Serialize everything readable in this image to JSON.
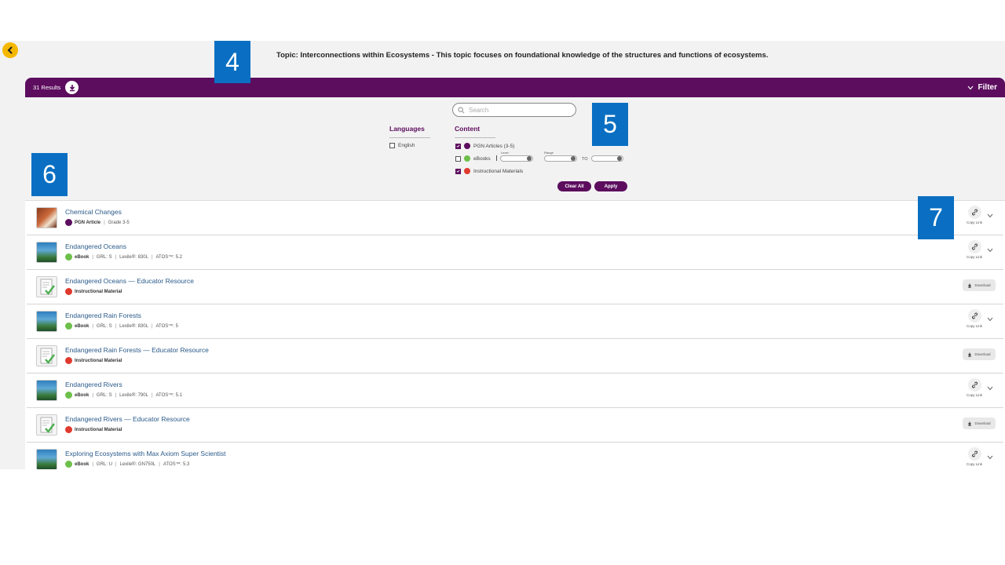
{
  "topic_text": "Topic: Interconnections within Ecosystems - This topic focuses on foundational knowledge of the structures and functions of ecosystems.",
  "results_bar": {
    "count": "31 Results",
    "filter_label": "Filter"
  },
  "search": {
    "placeholder": "Search"
  },
  "filters": {
    "languages": {
      "heading": "Languages",
      "options": [
        {
          "label": "English",
          "checked": false
        }
      ]
    },
    "content": {
      "heading": "Content",
      "options": [
        {
          "label": "PGN Articles (3-5)",
          "checked": true
        },
        {
          "label": "eBooks",
          "checked": false
        },
        {
          "label": "Instructional Materials",
          "checked": true
        }
      ],
      "level_label": "Level",
      "range_label": "Range",
      "to_label": "TO"
    },
    "clear_label": "Clear All",
    "apply_label": "Apply"
  },
  "items": [
    {
      "title": "Chemical Changes",
      "type": "PGN Article",
      "details": [
        "Grade 3-5"
      ],
      "action": "copy"
    },
    {
      "title": "Endangered Oceans",
      "type": "eBook",
      "details": [
        "GRL: S",
        "Lexile®: 830L",
        "ATOS™: 5.2"
      ],
      "action": "copy"
    },
    {
      "title": "Endangered Oceans — Educator Resource",
      "type": "Instructional Material",
      "details": [],
      "action": "download"
    },
    {
      "title": "Endangered Rain Forests",
      "type": "eBook",
      "details": [
        "GRL: S",
        "Lexile®: 830L",
        "ATOS™: 5"
      ],
      "action": "copy"
    },
    {
      "title": "Endangered Rain Forests — Educator Resource",
      "type": "Instructional Material",
      "details": [],
      "action": "download"
    },
    {
      "title": "Endangered Rivers",
      "type": "eBook",
      "details": [
        "GRL: S",
        "Lexile®: 790L",
        "ATOS™: 5.1"
      ],
      "action": "copy"
    },
    {
      "title": "Endangered Rivers — Educator Resource",
      "type": "Instructional Material",
      "details": [],
      "action": "download"
    },
    {
      "title": "Exploring Ecosystems with Max Axiom Super Scientist",
      "type": "eBook",
      "details": [
        "GRL: U",
        "Lexile®: GN750L",
        "ATOS™: 5.3"
      ],
      "action": "copy"
    }
  ],
  "copy_link_label": "Copy Link",
  "download_label": "Download",
  "callouts": [
    "4",
    "5",
    "6",
    "7"
  ],
  "colors": {
    "brand_purple": "#5c0d5e",
    "callout_blue": "#0a6fc2",
    "back_yellow": "#f5b800",
    "ebook_green": "#6cc04a",
    "material_red": "#e03a2e"
  }
}
